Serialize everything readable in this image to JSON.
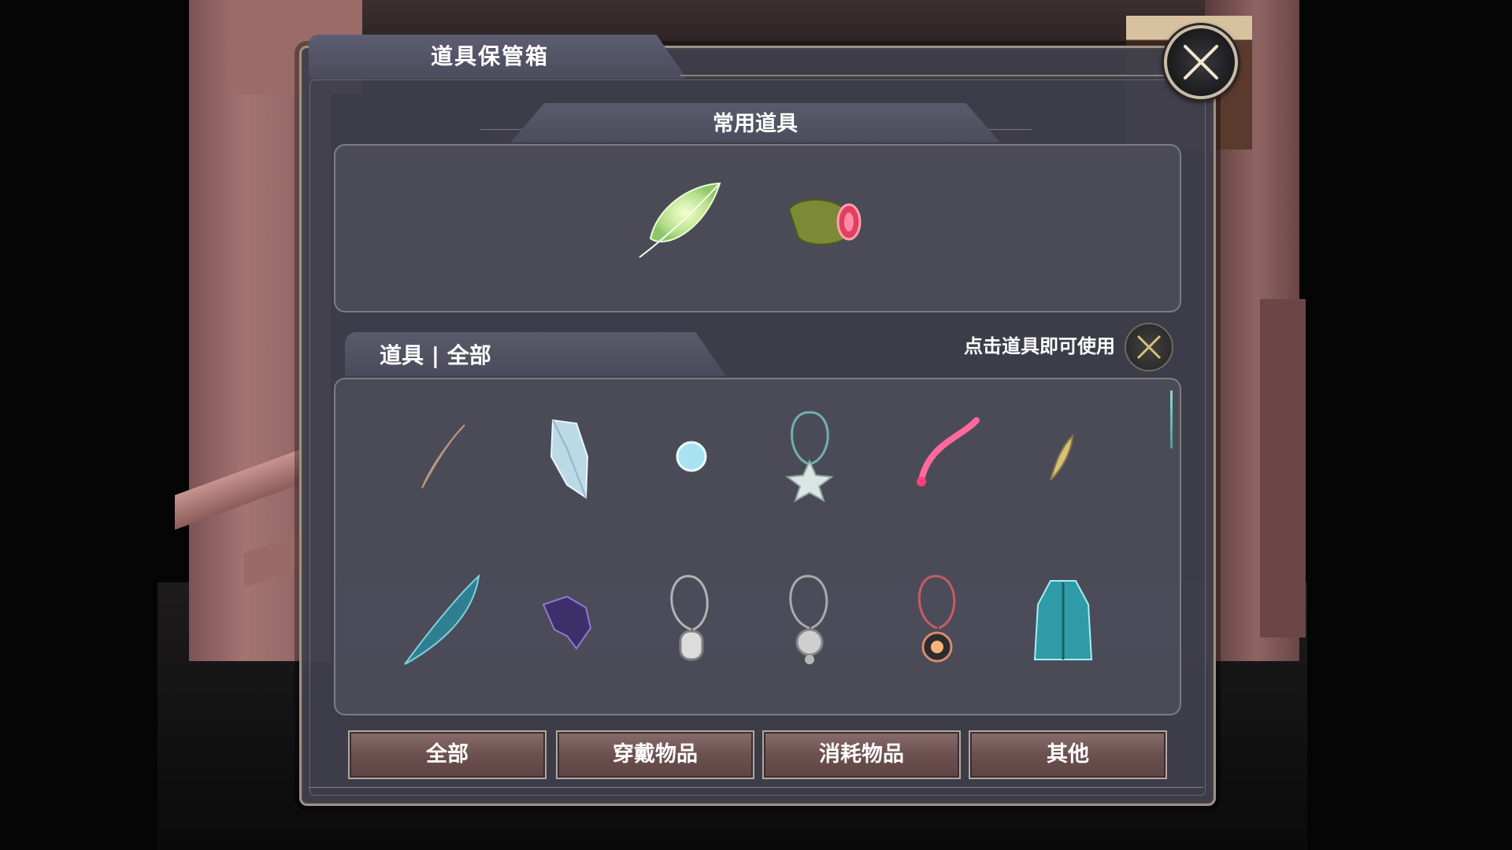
{
  "window": {
    "title": "道具保管箱"
  },
  "quick_section": {
    "title": "常用道具",
    "items": [
      {
        "icon": "green-leaf-icon"
      },
      {
        "icon": "meat-roll-icon"
      }
    ]
  },
  "items_section": {
    "tab_label": "道具 | 全部",
    "hint": "点击道具即可使用",
    "hint_icon": "crossed-swords-icon",
    "items": [
      {
        "icon": "white-feather-icon"
      },
      {
        "icon": "ice-crystal-icon"
      },
      {
        "icon": "blue-orb-icon"
      },
      {
        "icon": "star-pendant-icon"
      },
      {
        "icon": "red-tail-feather-icon"
      },
      {
        "icon": "golden-feather-icon"
      },
      {
        "icon": "teal-feather-icon"
      },
      {
        "icon": "dark-crystal-icon"
      },
      {
        "icon": "silver-pendant-icon"
      },
      {
        "icon": "flower-pendant-icon"
      },
      {
        "icon": "sun-pendant-icon"
      },
      {
        "icon": "teal-robe-icon"
      }
    ]
  },
  "categories": [
    {
      "label": "全部"
    },
    {
      "label": "穿戴物品"
    },
    {
      "label": "消耗物品"
    },
    {
      "label": "其他"
    }
  ],
  "colors": {
    "panel": "#40404c",
    "button": "#6c5050",
    "accent": "#c8bca8"
  }
}
